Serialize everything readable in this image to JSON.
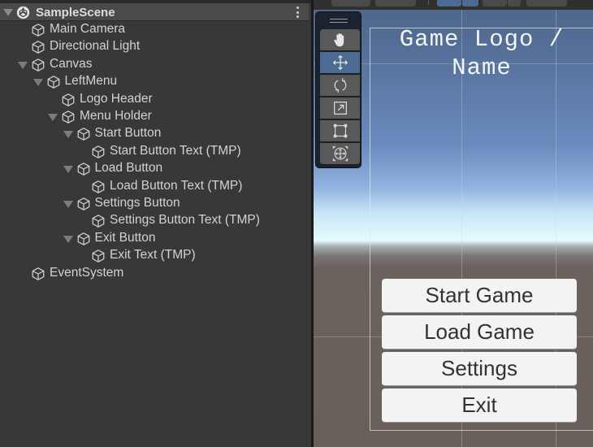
{
  "hierarchy": {
    "scene_name": "SampleScene",
    "items": [
      {
        "label": "Main Camera",
        "depth": 0,
        "expandable": false
      },
      {
        "label": "Directional Light",
        "depth": 0,
        "expandable": false
      },
      {
        "label": "Canvas",
        "depth": 0,
        "expandable": true
      },
      {
        "label": "LeftMenu",
        "depth": 1,
        "expandable": true
      },
      {
        "label": "Logo Header",
        "depth": 2,
        "expandable": false
      },
      {
        "label": "Menu Holder",
        "depth": 2,
        "expandable": true
      },
      {
        "label": "Start Button",
        "depth": 3,
        "expandable": true
      },
      {
        "label": "Start Button Text (TMP)",
        "depth": 4,
        "expandable": false
      },
      {
        "label": "Load Button",
        "depth": 3,
        "expandable": true
      },
      {
        "label": "Load Button Text (TMP)",
        "depth": 4,
        "expandable": false
      },
      {
        "label": "Settings Button",
        "depth": 3,
        "expandable": true
      },
      {
        "label": "Settings Button Text (TMP)",
        "depth": 4,
        "expandable": false
      },
      {
        "label": "Exit Button",
        "depth": 3,
        "expandable": true
      },
      {
        "label": "Exit Text (TMP)",
        "depth": 4,
        "expandable": false
      },
      {
        "label": "EventSystem",
        "depth": 0,
        "expandable": false
      }
    ]
  },
  "scene_view": {
    "tools": [
      {
        "name": "hand-tool",
        "icon": "hand-icon",
        "active": false
      },
      {
        "name": "move-tool",
        "icon": "move-icon",
        "active": true
      },
      {
        "name": "rotate-tool",
        "icon": "rotate-icon",
        "active": false
      },
      {
        "name": "scale-tool",
        "icon": "scale-icon",
        "active": false
      },
      {
        "name": "rect-tool",
        "icon": "rect-icon",
        "active": false
      },
      {
        "name": "transform-tool",
        "icon": "transform-icon",
        "active": false
      }
    ],
    "logo_text": "Game Logo / Name",
    "menu_buttons": [
      "Start Game",
      "Load Game",
      "Settings",
      "Exit"
    ]
  },
  "colors": {
    "active_tool": "#4b6b92",
    "panel_bg": "#383838",
    "button_bg": "#f3f3f3",
    "button_text": "#323232"
  }
}
